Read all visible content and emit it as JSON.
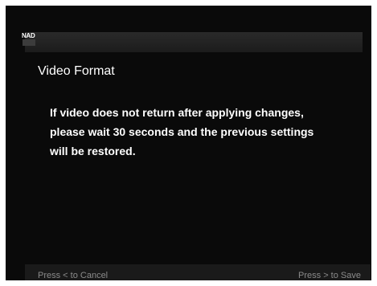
{
  "brand": {
    "logo_text": "NAD"
  },
  "dialog": {
    "title": "Video Format",
    "message_lines": [
      "If video does not return after applying changes,",
      "please wait 30 seconds and the previous settings",
      "will be restored."
    ]
  },
  "footer": {
    "cancel_label": "Press < to Cancel",
    "save_label": "Press > to Save"
  }
}
